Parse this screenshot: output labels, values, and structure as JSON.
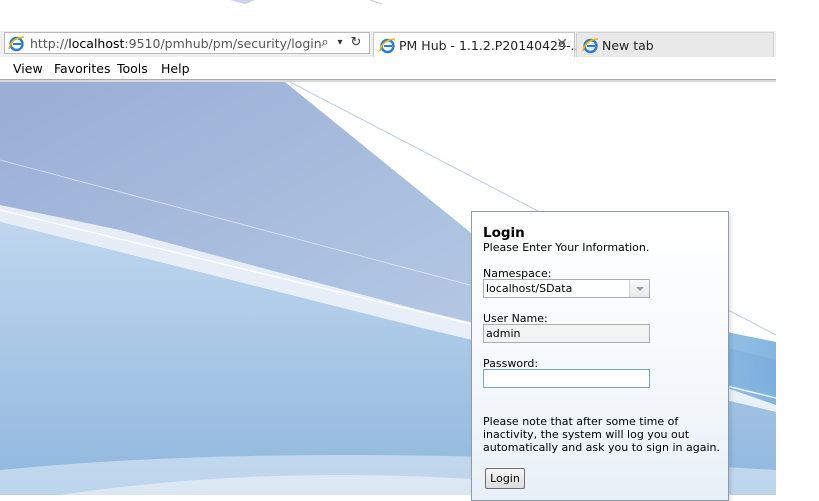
{
  "browser": {
    "address": {
      "prefix": "http://",
      "host": "localhost",
      "path": ":9510/pmhub/pm/security/login"
    },
    "address_buttons": {
      "search": "⌕",
      "dropdown": "▾",
      "refresh": "↻"
    },
    "tabs": [
      {
        "label": "PM Hub - 1.1.2.P20140429-...",
        "close": "✕"
      },
      {
        "label": "New tab"
      }
    ],
    "menu": [
      "View",
      "Favorites",
      "Tools",
      "Help"
    ]
  },
  "login": {
    "title": "Login",
    "subtitle": "Please Enter Your Information.",
    "namespace_label": "Namespace:",
    "namespace_value": "localhost/SData",
    "username_label": "User Name:",
    "username_value": "admin",
    "password_label": "Password:",
    "password_value": "",
    "note": "Please note that after some time of inactivity, the system will log you out automatically and ask you to sign in again.",
    "button": "Login"
  },
  "colors": {
    "background_blue": "#a8bedf",
    "stripe_blue": "#8fbbe0",
    "panel_border": "#8f9ba8"
  },
  "icons": {
    "browser_logo": "internet-explorer-icon"
  }
}
